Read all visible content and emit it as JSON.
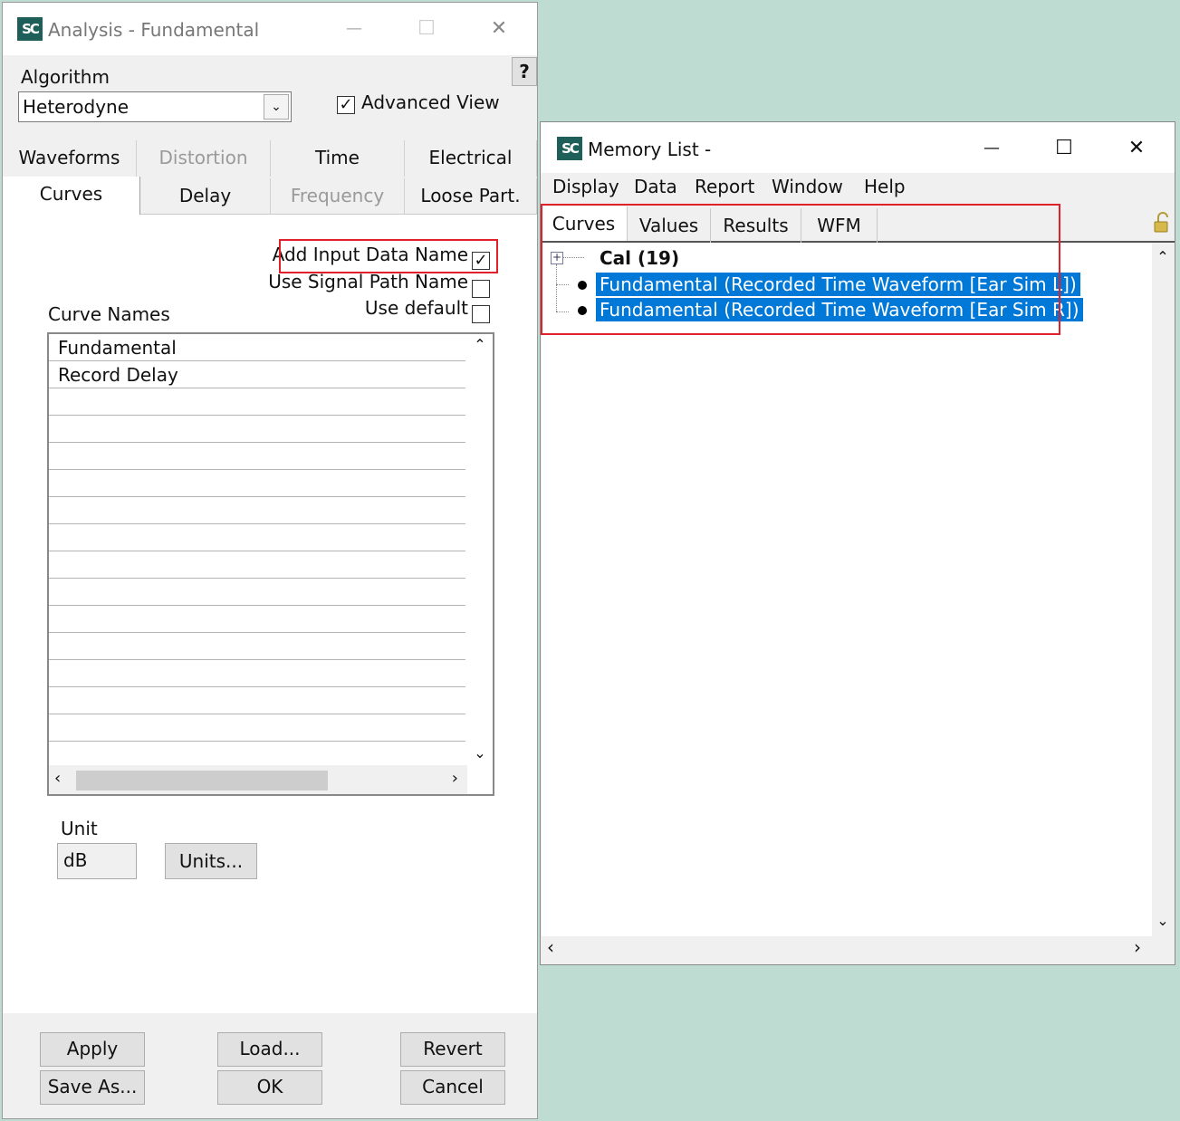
{
  "analysis": {
    "title": "Analysis  - Fundamental",
    "logo": "SC",
    "help_label": "?",
    "algorithm_label": "Algorithm",
    "algorithm_value": "Heterodyne",
    "advanced_view_label": "Advanced View",
    "advanced_view_checked": true,
    "tabs_row1": [
      {
        "label": "Waveforms",
        "enabled": true
      },
      {
        "label": "Distortion",
        "enabled": false
      },
      {
        "label": "Time",
        "enabled": true
      },
      {
        "label": "Electrical",
        "enabled": true
      }
    ],
    "tabs_row2": [
      {
        "label": "Curves",
        "enabled": true,
        "active": true
      },
      {
        "label": "Delay",
        "enabled": true
      },
      {
        "label": "Frequency",
        "enabled": false
      },
      {
        "label": "Loose Part.",
        "enabled": true
      }
    ],
    "options": {
      "add_input_data_name": {
        "label": "Add Input Data Name",
        "checked": true
      },
      "use_signal_path_name": {
        "label": "Use Signal Path Name",
        "checked": false
      },
      "use_default": {
        "label": "Use default",
        "checked": false
      }
    },
    "curve_names_label": "Curve Names",
    "curve_names": [
      "Fundamental",
      "Record Delay",
      "",
      "",
      "",
      "",
      "",
      "",
      "",
      "",
      "",
      "",
      "",
      "",
      "",
      ""
    ],
    "unit_label": "Unit",
    "unit_value": "dB",
    "units_button": "Units...",
    "buttons": {
      "apply": "Apply",
      "load": "Load...",
      "revert": "Revert",
      "save_as": "Save As...",
      "ok": "OK",
      "cancel": "Cancel"
    },
    "window_controls": {
      "minimize": "—",
      "maximize": "☐",
      "close": "✕"
    }
  },
  "memory": {
    "title": "Memory List -",
    "logo": "SC",
    "menu": [
      "Display",
      "Data",
      "Report",
      "Window",
      "Help"
    ],
    "tabs": [
      {
        "label": "Curves",
        "active": true
      },
      {
        "label": "Values"
      },
      {
        "label": "Results"
      },
      {
        "label": "WFM"
      }
    ],
    "tree": {
      "group": "Cal (19)",
      "items": [
        "Fundamental (Recorded Time Waveform [Ear Sim L])",
        "Fundamental (Recorded Time Waveform [Ear Sim R])"
      ]
    },
    "window_controls": {
      "minimize": "—",
      "maximize": "☐",
      "close": "✕"
    }
  },
  "colors": {
    "desktop": "#bfdcd3",
    "highlight": "#0078d7",
    "annotation": "#e0202a"
  }
}
